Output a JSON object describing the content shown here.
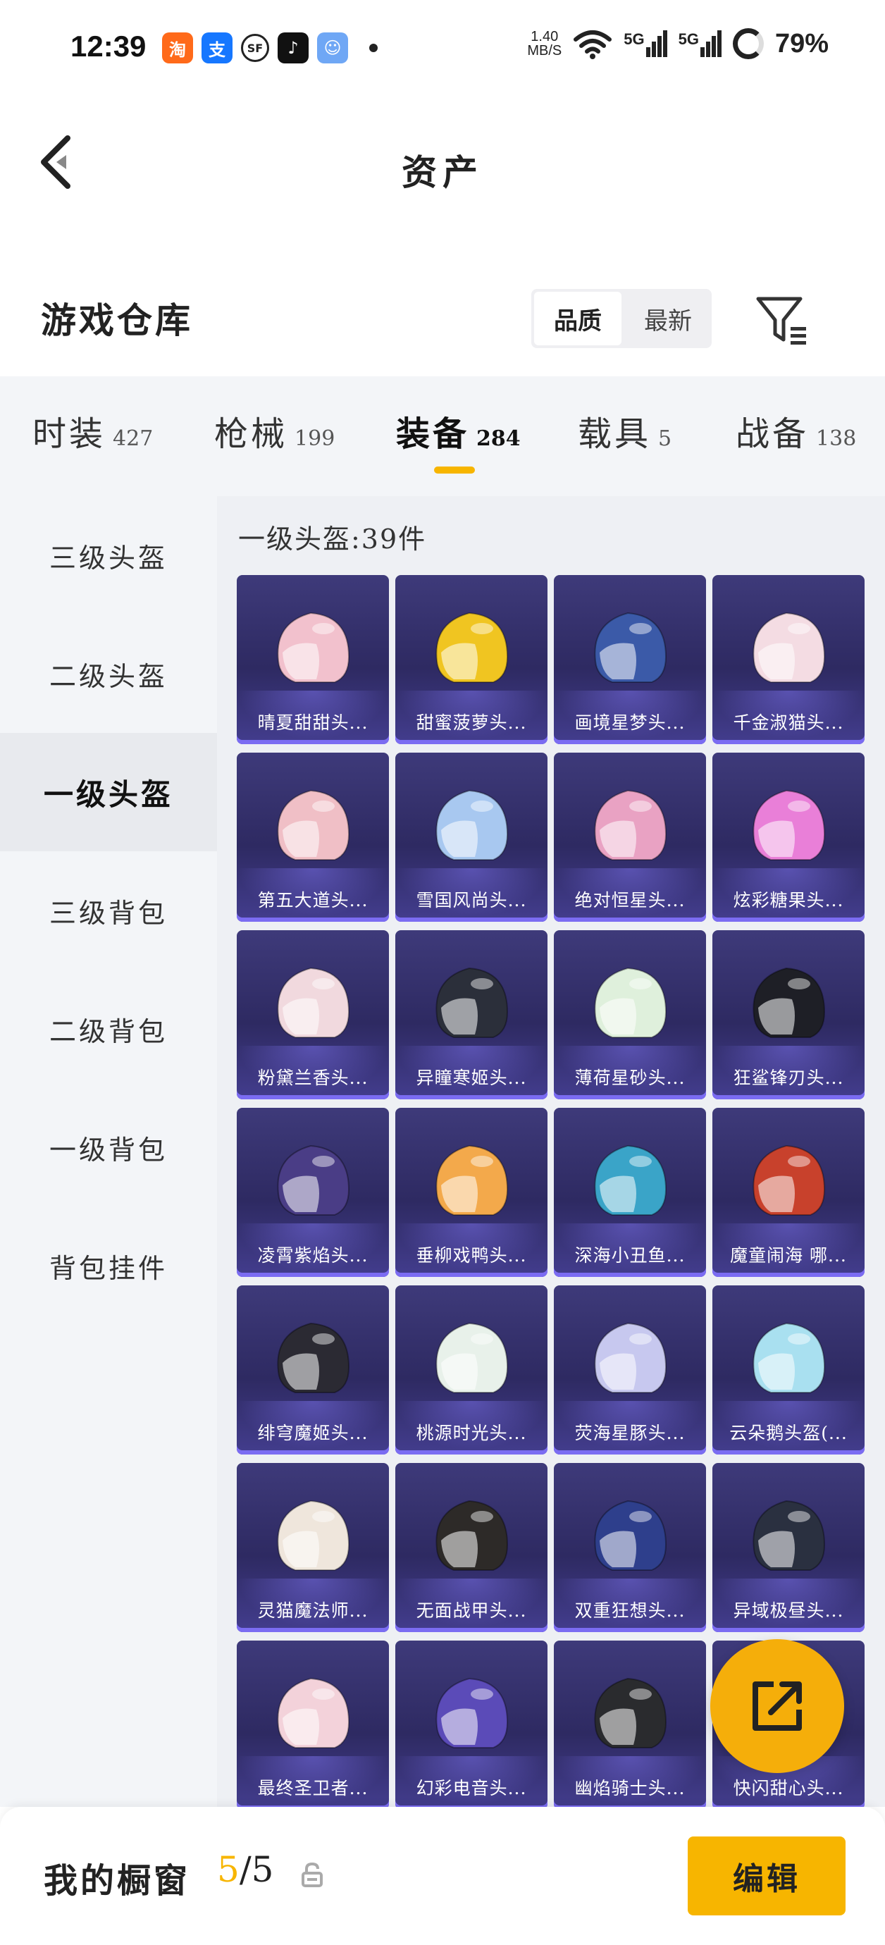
{
  "status_bar": {
    "time": "12:39",
    "net_speed_value": "1.40",
    "net_speed_unit": "MB/S",
    "signal_1": "5G",
    "signal_2": "5G",
    "battery": "79%",
    "apps": [
      "taobao-icon",
      "alipay-icon",
      "sf-express-icon",
      "tiktok-icon",
      "game-icon"
    ]
  },
  "header": {
    "title": "资产"
  },
  "warehouse": {
    "title": "游戏仓库",
    "sort_options": [
      "品质",
      "最新"
    ],
    "active_sort": "品质"
  },
  "category_tabs": [
    {
      "label": "时装",
      "count": "427"
    },
    {
      "label": "枪械",
      "count": "199"
    },
    {
      "label": "装备",
      "count": "284",
      "active": true
    },
    {
      "label": "载具",
      "count": "5"
    },
    {
      "label": "战备",
      "count": "138"
    }
  ],
  "side_nav": [
    {
      "label": "三级头盔"
    },
    {
      "label": "二级头盔"
    },
    {
      "label": "一级头盔",
      "active": true
    },
    {
      "label": "三级背包"
    },
    {
      "label": "二级背包"
    },
    {
      "label": "一级背包"
    },
    {
      "label": "背包挂件"
    }
  ],
  "grid": {
    "heading": "一级头盔:39件",
    "items": [
      {
        "name": "晴夏甜甜头...",
        "color": "#f2c1cd"
      },
      {
        "name": "甜蜜菠萝头...",
        "color": "#f0c521"
      },
      {
        "name": "画境星梦头...",
        "color": "#3b5aa8"
      },
      {
        "name": "千金淑猫头...",
        "color": "#f4dce3"
      },
      {
        "name": "第五大道头...",
        "color": "#f0bfc6"
      },
      {
        "name": "雪国风尚头...",
        "color": "#a8c8f0"
      },
      {
        "name": "绝对恒星头...",
        "color": "#e9a2c3"
      },
      {
        "name": "炫彩糖果头...",
        "color": "#e97fd8"
      },
      {
        "name": "粉黛兰香头...",
        "color": "#f1d9de"
      },
      {
        "name": "异瞳寒姬头...",
        "color": "#2b2f3a"
      },
      {
        "name": "薄荷星砂头...",
        "color": "#dff0dc"
      },
      {
        "name": "狂鲨锋刃头...",
        "color": "#1e1f26"
      },
      {
        "name": "凌霄紫焰头...",
        "color": "#4a3d86"
      },
      {
        "name": "垂柳戏鸭头...",
        "color": "#f3a94b"
      },
      {
        "name": "深海小丑鱼...",
        "color": "#3aa4c8"
      },
      {
        "name": "魔童闹海 哪...",
        "color": "#c8412c"
      },
      {
        "name": "绯穹魔姬头...",
        "color": "#2b2a33"
      },
      {
        "name": "桃源时光头...",
        "color": "#e8f1ea"
      },
      {
        "name": "荧海星豚头...",
        "color": "#c7c8ef"
      },
      {
        "name": "云朵鹅头盔(...",
        "color": "#a9e0f0"
      },
      {
        "name": "灵猫魔法师...",
        "color": "#efe6dc"
      },
      {
        "name": "无面战甲头...",
        "color": "#2d2a28"
      },
      {
        "name": "双重狂想头...",
        "color": "#2e3f8c"
      },
      {
        "name": "异域极昼头...",
        "color": "#2a3040"
      },
      {
        "name": "最终圣卫者...",
        "color": "#f3d2da"
      },
      {
        "name": "幻彩电音头...",
        "color": "#5b4bb8"
      },
      {
        "name": "幽焰骑士头...",
        "color": "#2a2b2e"
      },
      {
        "name": "快闪甜心头...",
        "color": "#e97fa8"
      }
    ]
  },
  "bottom_bar": {
    "label": "我的橱窗",
    "current": "5",
    "total": "/5",
    "edit_label": "编辑"
  }
}
